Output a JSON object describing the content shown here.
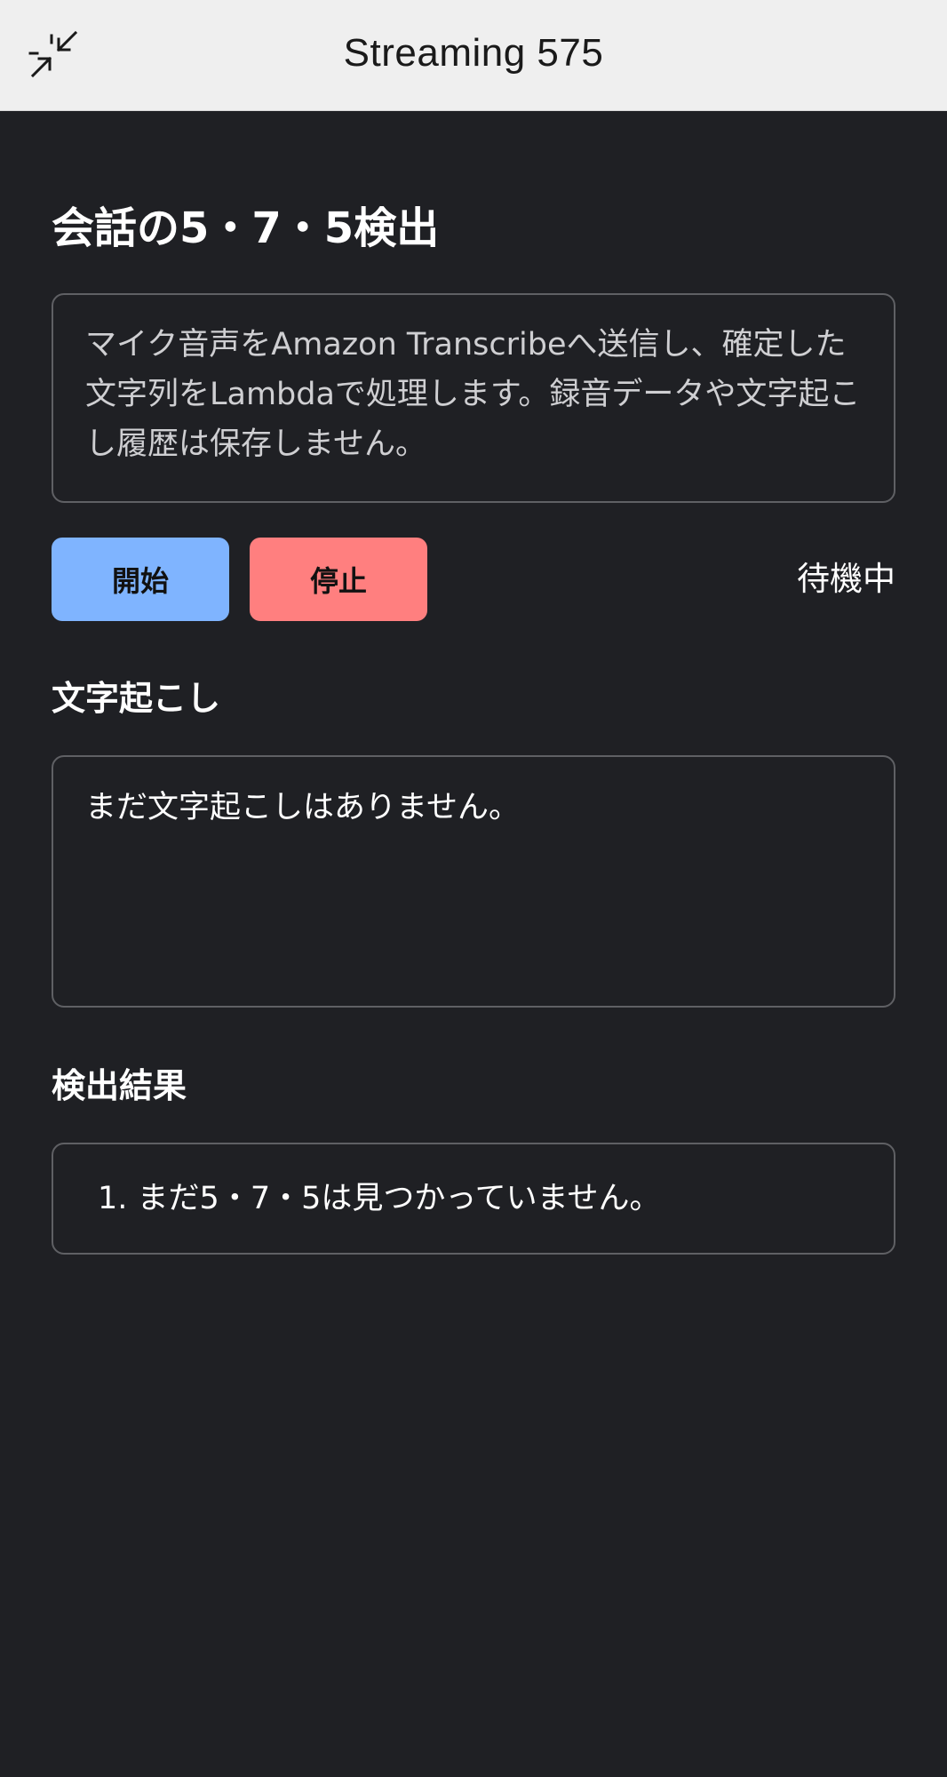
{
  "header": {
    "title": "Streaming 575",
    "collapse_icon": "collapse-arrows-icon"
  },
  "page": {
    "title": "会話の5・7・5検出",
    "notice": "マイク音声をAmazon Transcribeへ送信し、確定した文字列をLambdaで処理します。録音データや文字起こし履歴は保存しません。"
  },
  "controls": {
    "start_label": "開始",
    "stop_label": "停止",
    "status": "待機中",
    "start_color": "#7fb4ff",
    "stop_color": "#ff7f7f"
  },
  "transcript": {
    "heading": "文字起こし",
    "empty_text": "まだ文字起こしはありません。"
  },
  "results": {
    "heading": "検出結果",
    "items": [
      {
        "index": "1.",
        "text": "まだ5・7・5は見つかっていません。"
      }
    ]
  }
}
